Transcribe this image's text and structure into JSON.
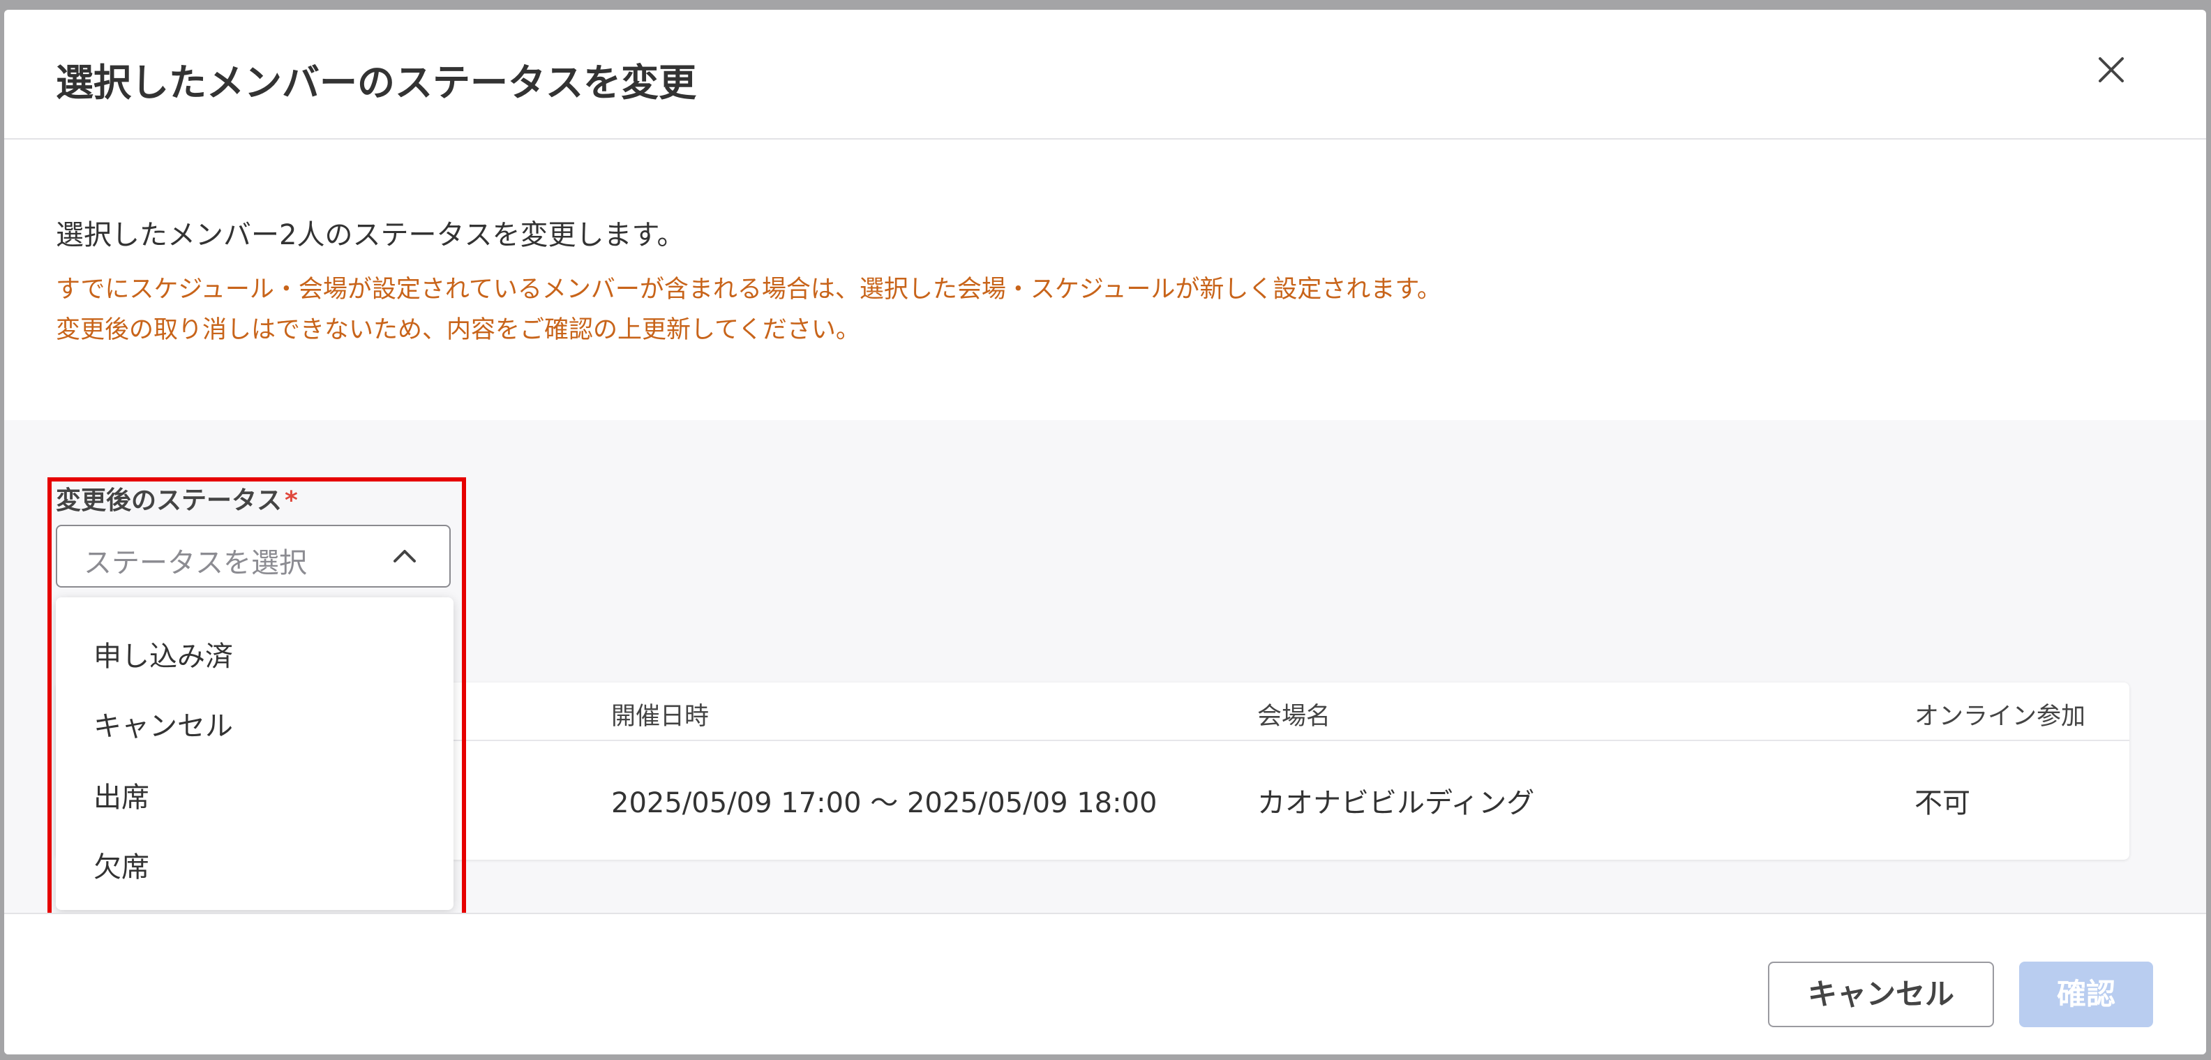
{
  "modal": {
    "title": "選択したメンバーのステータスを変更",
    "intro": "選択したメンバー2人のステータスを変更します。",
    "warning_line1": "すでにスケジュール・会場が設定されているメンバーが含まれる場合は、選択した会場・スケジュールが新しく設定されます。",
    "warning_line2": "変更後の取り消しはできないため、内容をご確認の上更新してください。"
  },
  "status_field": {
    "label": "変更後のステータス",
    "required_mark": "*",
    "placeholder": "ステータスを選択",
    "options": [
      "申し込み済",
      "キャンセル",
      "出席",
      "欠席"
    ]
  },
  "table": {
    "headers": [
      "開催日時",
      "会場名",
      "オンライン参加"
    ],
    "rows": [
      [
        "2025/05/09 17:00 〜 2025/05/09 18:00",
        "カオナビビルディング",
        "不可"
      ]
    ]
  },
  "footer": {
    "cancel_label": "キャンセル",
    "confirm_label": "確認"
  },
  "colors": {
    "warning": "#c8641a",
    "required": "#e0483d",
    "highlight": "#e60000",
    "confirm_disabled": "#b9cdf0"
  },
  "icons": {
    "close": "close-icon",
    "chevron": "chevron-up-icon"
  }
}
